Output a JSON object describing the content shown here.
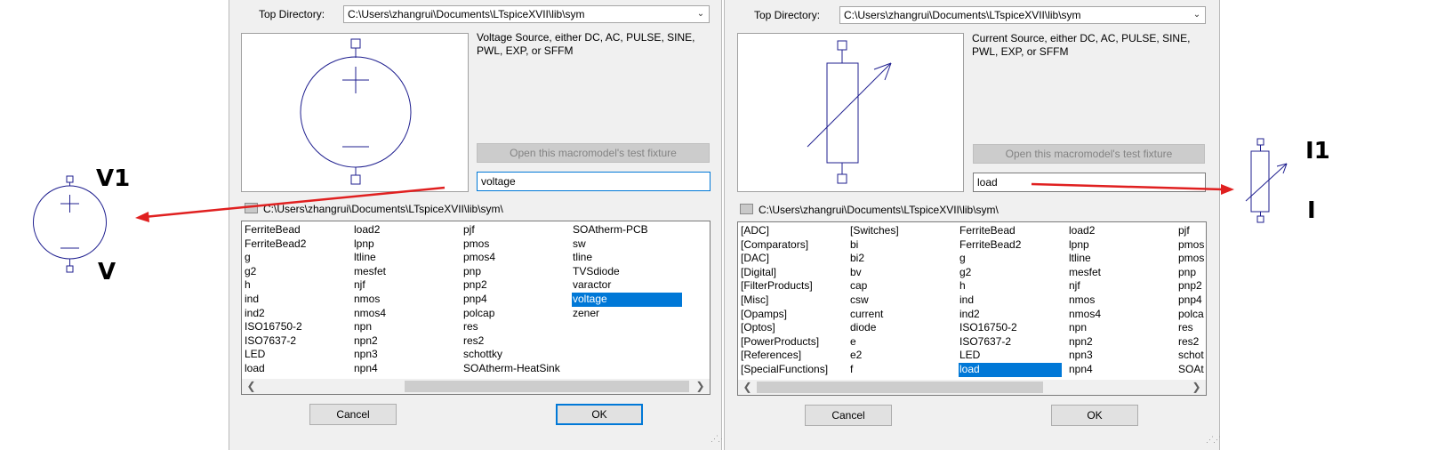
{
  "left_dialog": {
    "top_dir_label": "Top Directory:",
    "top_dir_value": "C:\\Users\\zhangrui\\Documents\\LTspiceXVII\\lib\\sym",
    "description": [
      "Voltage Source, either DC, AC, PULSE, SINE,",
      "PWL, EXP, or SFFM"
    ],
    "test_fixture_label": "Open this macromodel's test fixture",
    "search_value": "voltage",
    "path": "C:\\Users\\zhangrui\\Documents\\LTspiceXVII\\lib\\sym\\",
    "columns": [
      [
        "FerriteBead",
        "FerriteBead2",
        "g",
        "g2",
        "h",
        "ind",
        "ind2",
        "ISO16750-2",
        "ISO7637-2",
        "LED",
        "load"
      ],
      [
        "load2",
        "lpnp",
        "ltline",
        "mesfet",
        "njf",
        "nmos",
        "nmos4",
        "npn",
        "npn2",
        "npn3",
        "npn4"
      ],
      [
        "pjf",
        "pmos",
        "pmos4",
        "pnp",
        "pnp2",
        "pnp4",
        "polcap",
        "res",
        "res2",
        "schottky",
        "SOAtherm-HeatSink"
      ],
      [
        "SOAtherm-PCB",
        "sw",
        "tline",
        "TVSdiode",
        "varactor",
        "voltage",
        "zener"
      ]
    ],
    "selected": "voltage",
    "cancel_label": "Cancel",
    "ok_label": "OK"
  },
  "right_dialog": {
    "top_dir_label": "Top Directory:",
    "top_dir_value": "C:\\Users\\zhangrui\\Documents\\LTspiceXVII\\lib\\sym",
    "description": [
      "Current Source, either DC, AC, PULSE, SINE,",
      "PWL, EXP, or SFFM"
    ],
    "test_fixture_label": "Open this macromodel's test fixture",
    "search_value": "load",
    "path": "C:\\Users\\zhangrui\\Documents\\LTspiceXVII\\lib\\sym\\",
    "columns": [
      [
        "[ADC]",
        "[Comparators]",
        "[DAC]",
        "[Digital]",
        "[FilterProducts]",
        "[Misc]",
        "[Opamps]",
        "[Optos]",
        "[PowerProducts]",
        "[References]",
        "[SpecialFunctions]"
      ],
      [
        "[Switches]",
        "bi",
        "bi2",
        "bv",
        "cap",
        "csw",
        "current",
        "diode",
        "e",
        "e2",
        "f"
      ],
      [
        "FerriteBead",
        "FerriteBead2",
        "g",
        "g2",
        "h",
        "ind",
        "ind2",
        "ISO16750-2",
        "ISO7637-2",
        "LED",
        "load"
      ],
      [
        "load2",
        "lpnp",
        "ltline",
        "mesfet",
        "njf",
        "nmos",
        "nmos4",
        "npn",
        "npn2",
        "npn3",
        "npn4"
      ],
      [
        "pjf",
        "pmos",
        "pmos",
        "pnp",
        "pnp2",
        "pnp4",
        "polca",
        "res",
        "res2",
        "schot",
        "SOAt"
      ]
    ],
    "selected": "load",
    "cancel_label": "Cancel",
    "ok_label": "OK"
  },
  "annotations": {
    "v_name": "V1",
    "v_value": "V",
    "i_name": "I1",
    "i_value": "I"
  },
  "colors": {
    "symbol": "#1f1f8f",
    "arrow": "#e02020",
    "selection": "#0078d7"
  }
}
